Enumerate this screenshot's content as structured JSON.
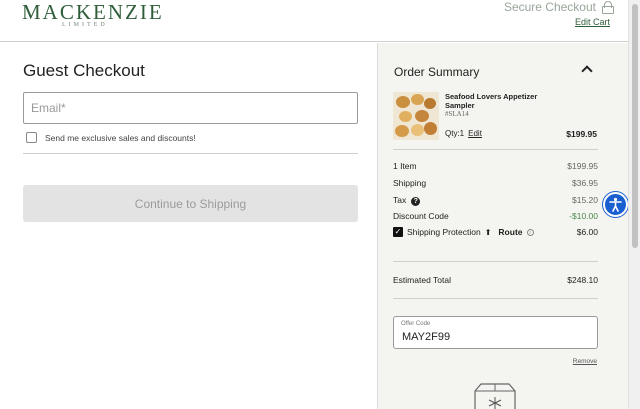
{
  "header": {
    "logo_main": "MACKENZIE",
    "logo_sub": "LIMITED",
    "secure_checkout": "Secure Checkout",
    "edit_cart": "Edit Cart"
  },
  "checkout": {
    "title": "Guest Checkout",
    "email_placeholder": "Email*",
    "optin_label": "Send me exclusive sales and discounts!",
    "continue_label": "Continue to Shipping"
  },
  "summary": {
    "title": "Order Summary",
    "product": {
      "name": "Seafood Lovers Appetizer Sampler",
      "sku": "#SLA14",
      "qty_label": "Qty:1",
      "edit": "Edit",
      "price": "$199.95"
    },
    "rows": [
      {
        "label": "1 Item",
        "value": "$199.95"
      },
      {
        "label": "Shipping",
        "value": "$36.95"
      },
      {
        "label": "Tax",
        "value": "$15.20"
      },
      {
        "label": "Discount Code",
        "value": "-$10.00"
      }
    ],
    "protection": {
      "label": "Shipping Protection",
      "brand": "Route",
      "value": "$6.00"
    },
    "estimated_total_label": "Estimated Total",
    "estimated_total": "$248.10",
    "offer_code_label": "Offer Code",
    "offer_code_value": "MAY2F99",
    "remove": "Remove"
  },
  "colors": {
    "brand_green": "#2f5d3a",
    "discount_green": "#4a8a4e",
    "a11y_blue": "#1a5fd0"
  }
}
